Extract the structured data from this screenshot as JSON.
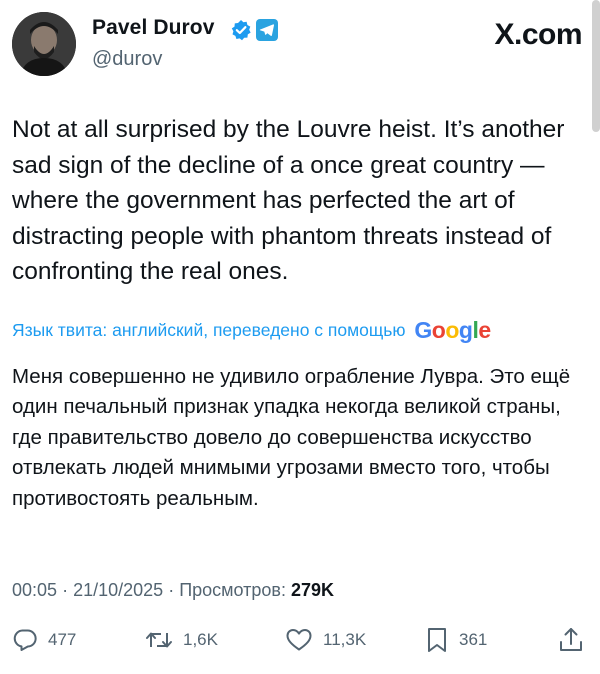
{
  "author": {
    "name": "Pavel Durov",
    "handle": "@durov",
    "verified_color": "#1d9bf0",
    "badge_icon": "telegram-icon"
  },
  "site": {
    "label": "X.com"
  },
  "tweet": {
    "text": "Not at all surprised by the Louvre heist. It’s another sad sign of the decline of a once great country — where the government has perfected the art of distracting people with phantom threats instead of confronting the real ones."
  },
  "translation": {
    "label": "Язык твита: английский, переведено с помощью",
    "provider_letters": [
      "G",
      "o",
      "o",
      "g",
      "l",
      "e"
    ],
    "provider_colors": [
      "#4285f4",
      "#ea4335",
      "#fbbc05",
      "#4285f4",
      "#34a853",
      "#ea4335"
    ],
    "text": "Меня совершенно не удивило ограбление Лувра. Это ещё один печальный признак упадка некогда великой страны, где правительство довело до совершенства искусство отвлекать людей мнимыми угрозами вместо того, чтобы противостоять реальным."
  },
  "meta": {
    "time": "00:05",
    "date": "21/10/2025",
    "separator": "·",
    "views_label": "Просмотров:",
    "views_count": "279K"
  },
  "actions": {
    "replies": "477",
    "reposts": "1,6K",
    "likes": "11,3K",
    "bookmarks": "361"
  },
  "colors": {
    "text": "#0f1419",
    "secondary": "#536471",
    "link": "#1d9bf0"
  }
}
